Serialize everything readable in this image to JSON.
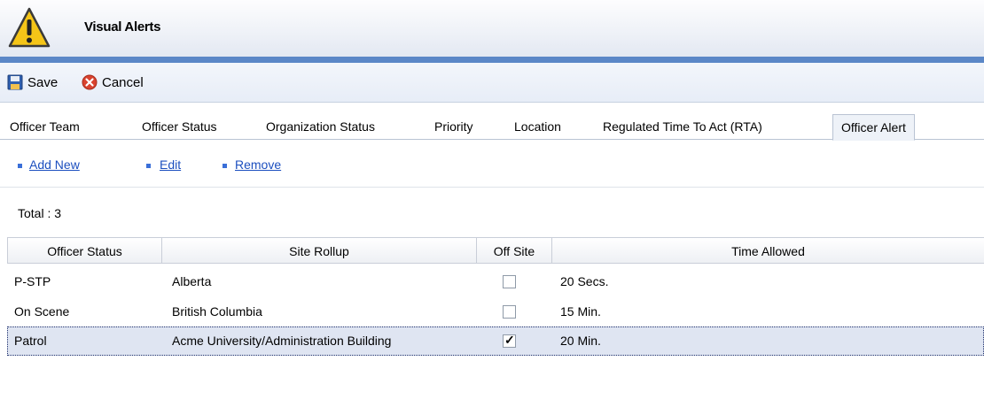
{
  "window": {
    "title": "Visual Alerts",
    "icon": "warning-triangle-icon"
  },
  "toolbar": {
    "save_label": "Save",
    "cancel_label": "Cancel"
  },
  "tabs": [
    {
      "label": "Officer Team"
    },
    {
      "label": "Officer Status"
    },
    {
      "label": "Organization Status"
    },
    {
      "label": "Priority"
    },
    {
      "label": "Location"
    },
    {
      "label": "Regulated Time To Act (RTA)"
    },
    {
      "label": "Officer Alert",
      "active": true
    }
  ],
  "actions": {
    "add_new": "Add New",
    "edit": "Edit",
    "remove": "Remove"
  },
  "total_label": "Total : 3",
  "grid": {
    "columns": [
      "Officer Status",
      "Site Rollup",
      "Off Site",
      "Time Allowed"
    ],
    "rows": [
      {
        "officer_status": "P-STP",
        "site_rollup": "Alberta",
        "off_site": false,
        "time_allowed": "20 Secs."
      },
      {
        "officer_status": "On Scene",
        "site_rollup": "British Columbia",
        "off_site": false,
        "time_allowed": "15 Min."
      },
      {
        "officer_status": "Patrol",
        "site_rollup": "Acme University/Administration Building",
        "off_site": true,
        "time_allowed": "20 Min.",
        "selected": true
      }
    ]
  },
  "colors": {
    "title_rule": "#5b87c7",
    "link": "#1c4fbf",
    "selected_row": "#dfe5f2"
  }
}
